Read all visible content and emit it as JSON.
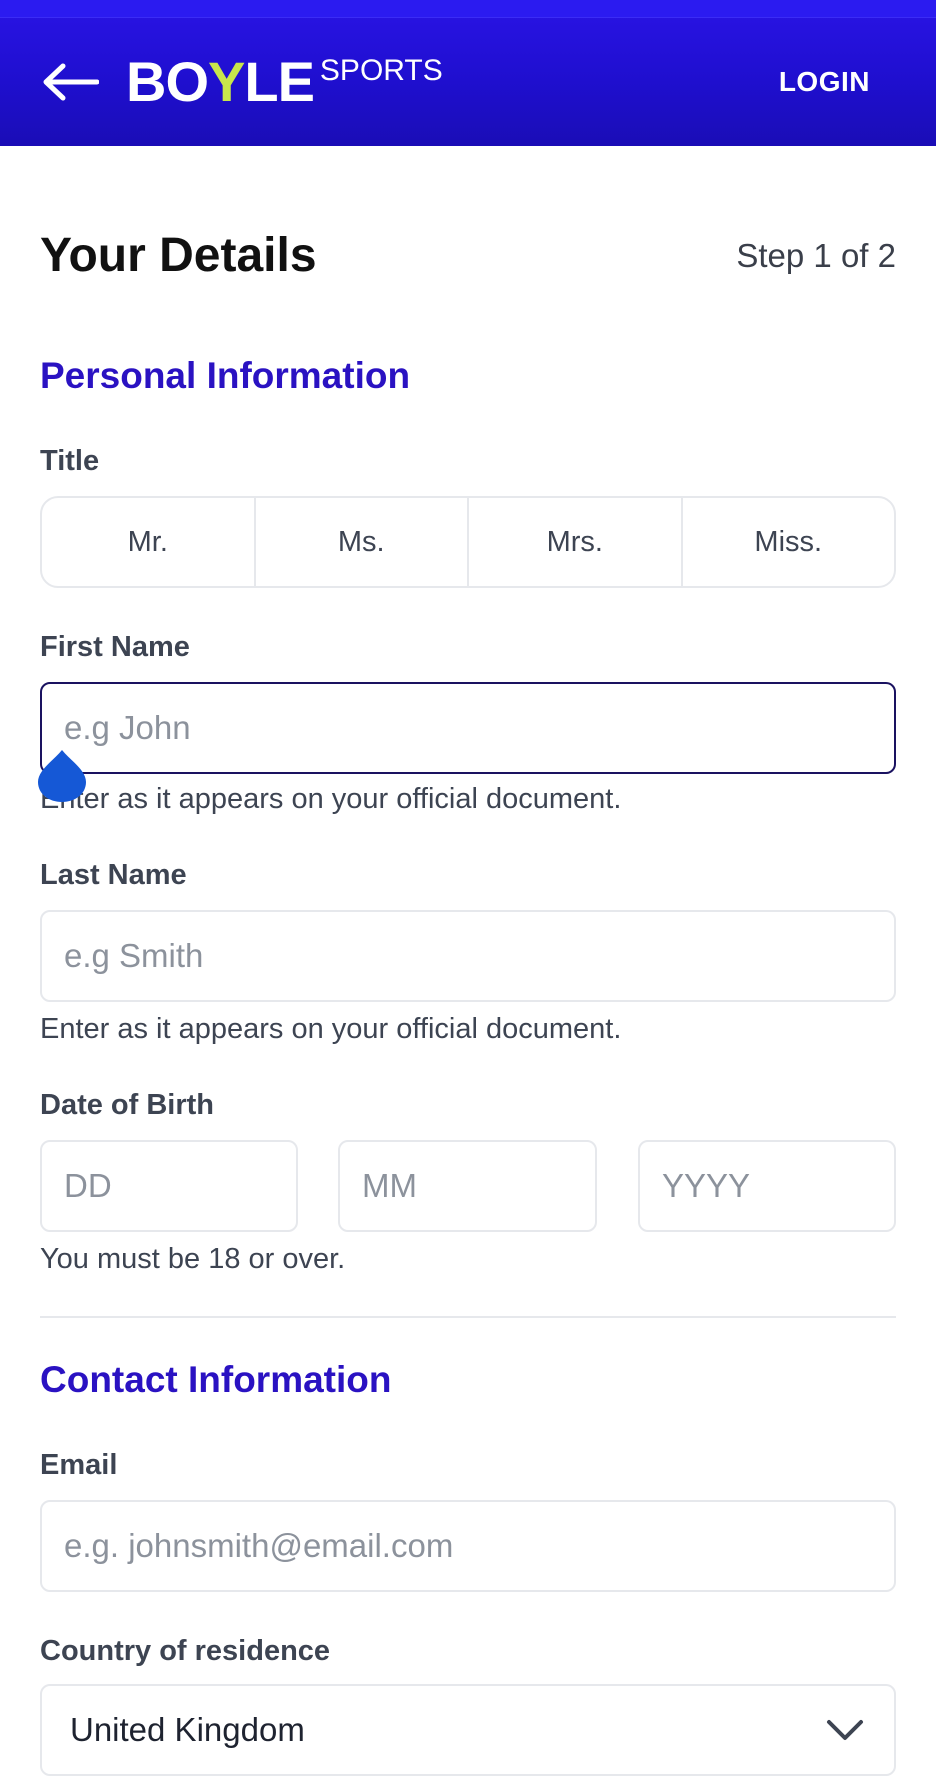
{
  "header": {
    "logo_main_a": "BO",
    "logo_main_y": "Y",
    "logo_main_b": "LE",
    "logo_sub": "SPORTS",
    "login_label": "LOGIN",
    "back_icon": "arrow-left-icon"
  },
  "page": {
    "title": "Your Details",
    "step": "Step 1 of 2"
  },
  "personal": {
    "section_title": "Personal Information",
    "title_label": "Title",
    "title_options": [
      "Mr.",
      "Ms.",
      "Mrs.",
      "Miss."
    ],
    "first_name_label": "First Name",
    "first_name_placeholder": "e.g John",
    "first_name_hint": "Enter as it appears on your official document.",
    "last_name_label": "Last Name",
    "last_name_placeholder": "e.g Smith",
    "last_name_hint": "Enter as it appears on your official document.",
    "dob_label": "Date of Birth",
    "dob_day_placeholder": "DD",
    "dob_month_placeholder": "MM",
    "dob_year_placeholder": "YYYY",
    "dob_hint": "You must be 18 or over."
  },
  "contact": {
    "section_title": "Contact Information",
    "email_label": "Email",
    "email_placeholder": "e.g. johnsmith@email.com",
    "country_label": "Country of residence",
    "country_value": "United Kingdom",
    "country_icon": "chevron-down-icon"
  },
  "colors": {
    "brand_blue": "#2a12c2",
    "header_blue": "#1f0fcf",
    "logo_accent": "#c8e64b",
    "focus_border": "#1a1260",
    "cursor_blue": "#1558d6"
  }
}
